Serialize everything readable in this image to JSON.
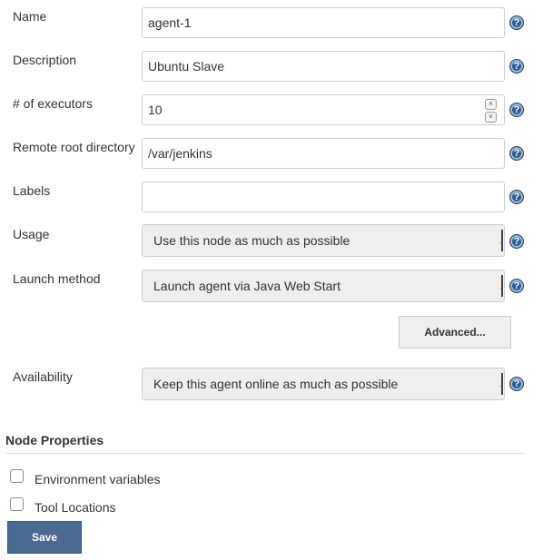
{
  "fields": {
    "name": {
      "label": "Name",
      "value": "agent-1"
    },
    "description": {
      "label": "Description",
      "value": "Ubuntu Slave"
    },
    "executors": {
      "label": "# of executors",
      "value": "10"
    },
    "remote_root": {
      "label": "Remote root directory",
      "value": "/var/jenkins"
    },
    "labels": {
      "label": "Labels",
      "value": ""
    },
    "usage": {
      "label": "Usage",
      "selected": "Use this node as much as possible"
    },
    "launch_method": {
      "label": "Launch method",
      "selected": "Launch agent via Java Web Start"
    },
    "availability": {
      "label": "Availability",
      "selected": "Keep this agent online as much as possible"
    }
  },
  "buttons": {
    "advanced": "Advanced...",
    "save": "Save"
  },
  "help_icon_glyph": "?",
  "spinner": {
    "up": "˄",
    "down": "˅"
  },
  "node_properties": {
    "title": "Node Properties",
    "items": [
      {
        "label": "Environment variables",
        "checked": false
      },
      {
        "label": "Tool Locations",
        "checked": false
      }
    ]
  },
  "colors": {
    "save_button_bg": "#4b6a92",
    "help_icon_bg": "#2f5b8f",
    "select_bg": "#eeeeee"
  },
  "icons": [
    "help-icon",
    "select-caret-icon",
    "spinner-up-icon",
    "spinner-down-icon"
  ]
}
